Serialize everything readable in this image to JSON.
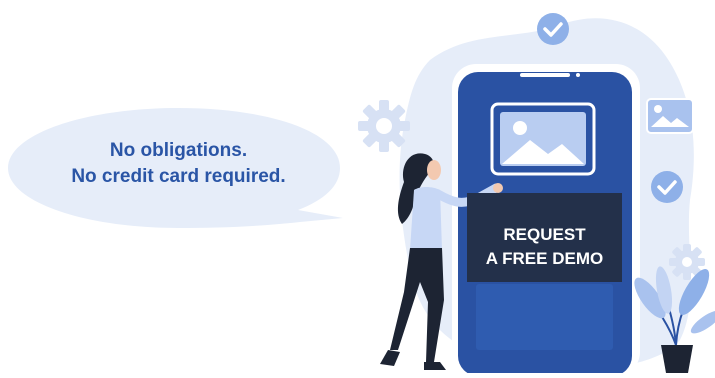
{
  "bubble": {
    "line1": "No obligations.",
    "line2": "No credit card required."
  },
  "cta": {
    "line1": "REQUEST",
    "line2": "A FREE DEMO"
  },
  "icons": {
    "check": "check-circle-icon",
    "gear": "gear-icon",
    "image": "image-icon",
    "plant": "potted-plant-icon"
  },
  "colors": {
    "accent": "#2a55a6",
    "phone": "#2a52a3",
    "cta_bg": "#23304a",
    "blob": "#e6edf9"
  }
}
